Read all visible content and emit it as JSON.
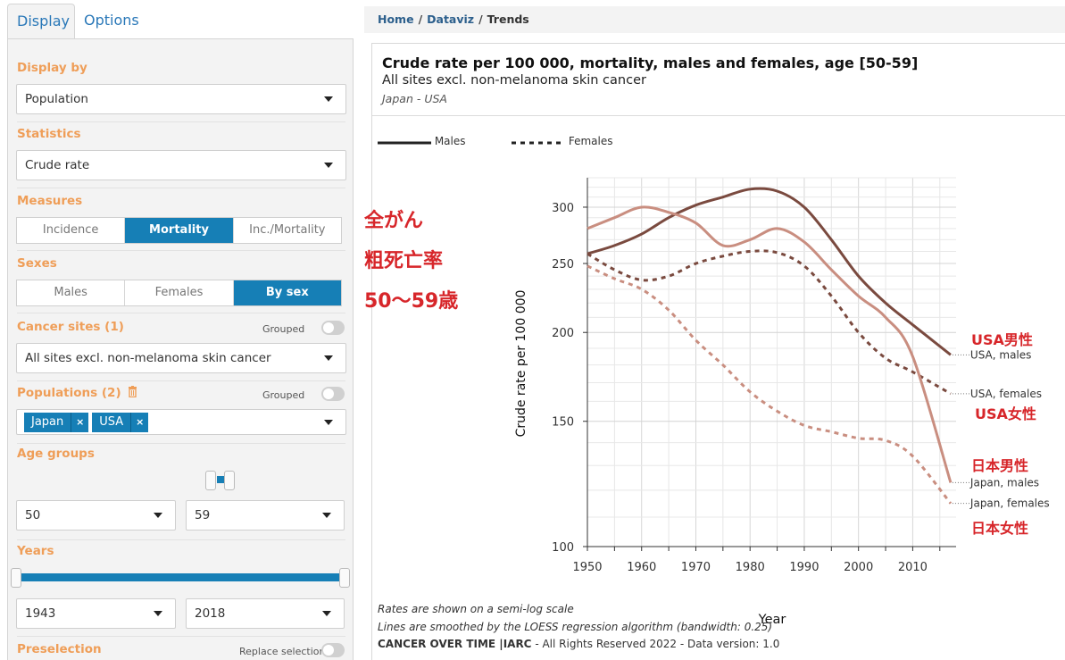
{
  "tabs": [
    {
      "label": "Display"
    },
    {
      "label": "Options"
    }
  ],
  "panel": {
    "display_by": {
      "label": "Display by",
      "value": "Population"
    },
    "statistics": {
      "label": "Statistics",
      "value": "Crude rate"
    },
    "measures": {
      "label": "Measures",
      "options": [
        "Incidence",
        "Mortality",
        "Inc./Mortality"
      ],
      "selected": "Mortality"
    },
    "sexes": {
      "label": "Sexes",
      "options": [
        "Males",
        "Females",
        "By sex"
      ],
      "selected": "By sex"
    },
    "cancer_sites": {
      "label": "Cancer sites (1)",
      "grouped_label": "Grouped",
      "value": "All sites excl. non-melanoma skin cancer"
    },
    "populations": {
      "label": "Populations (2)",
      "grouped_label": "Grouped",
      "chips": [
        "Japan",
        "USA"
      ]
    },
    "age_groups": {
      "label": "Age groups",
      "from": "50",
      "to": "59"
    },
    "years": {
      "label": "Years",
      "from": "1943",
      "to": "2018",
      "slider_from_fraction": 0.0,
      "slider_to_fraction": 1.0
    },
    "preselection": {
      "label": "Preselection",
      "replace_label": "Replace selection"
    }
  },
  "breadcrumb": {
    "items": [
      "Home",
      "Dataviz"
    ],
    "current": "Trends",
    "separator": "/"
  },
  "chart_header": {
    "title": "Crude rate per 100 000, mortality, males and females, age [50-59]",
    "subtitle": "All sites excl. non-melanoma skin cancer",
    "populations": "Japan - USA"
  },
  "legend": [
    {
      "label": "Males",
      "style": "solid"
    },
    {
      "label": "Females",
      "style": "dotted"
    }
  ],
  "notes": {
    "line1": "Rates are shown on a semi-log scale",
    "line2": "Lines are smoothed by the LOESS regression algorithm (bandwidth: 0.25)",
    "footer_brand": "CANCER OVER TIME |IARC",
    "footer_rest": " - All Rights Reserved 2022 - Data version: 1.0"
  },
  "annotations_jp": {
    "heading1": "全がん",
    "heading2": "粗死亡率",
    "heading3": "50～59歳",
    "usa_male": "USA男性",
    "usa_female": "USA女性",
    "japan_male": "日本男性",
    "japan_female": "日本女性"
  },
  "colors": {
    "usa_males": "#7a4a3f",
    "usa_females": "#7a4a3f",
    "japan_males": "#c98e80",
    "japan_females": "#c98e80",
    "accent_label": "#ef9e58",
    "primary": "#167fb6",
    "jp_red": "#d7262a"
  },
  "chart_data": {
    "type": "line",
    "xlabel": "Year",
    "ylabel": "Crude rate per 100 000",
    "y_scale": "log",
    "ylim": [
      100,
      330
    ],
    "xlim": [
      1950,
      2018
    ],
    "x_ticks": [
      1950,
      1960,
      1970,
      1980,
      1990,
      2000,
      2010
    ],
    "y_ticks": [
      100,
      150,
      200,
      250,
      300
    ],
    "grid": true,
    "series": [
      {
        "name": "USA, males",
        "sex": "male",
        "color": "#7a4a3f",
        "dash": "solid",
        "x": [
          1950,
          1955,
          1960,
          1965,
          1970,
          1975,
          1980,
          1985,
          1990,
          1995,
          2000,
          2005,
          2010,
          2017
        ],
        "y": [
          258,
          265,
          275,
          290,
          302,
          310,
          318,
          316,
          300,
          270,
          240,
          220,
          205,
          186
        ]
      },
      {
        "name": "USA, females",
        "sex": "female",
        "color": "#7a4a3f",
        "dash": "dotted",
        "x": [
          1950,
          1955,
          1960,
          1965,
          1970,
          1975,
          1980,
          1985,
          1990,
          1995,
          2000,
          2005,
          2010,
          2017
        ],
        "y": [
          258,
          245,
          237,
          240,
          250,
          256,
          260,
          259,
          248,
          225,
          200,
          184,
          176,
          164
        ]
      },
      {
        "name": "Japan, males",
        "sex": "male",
        "color": "#c98e80",
        "dash": "solid",
        "x": [
          1950,
          1955,
          1960,
          1965,
          1970,
          1975,
          1980,
          1985,
          1990,
          1995,
          2000,
          2005,
          2010,
          2017
        ],
        "y": [
          280,
          290,
          300,
          295,
          285,
          265,
          270,
          280,
          268,
          245,
          225,
          210,
          185,
          123
        ]
      },
      {
        "name": "Japan, females",
        "sex": "female",
        "color": "#c98e80",
        "dash": "dotted",
        "x": [
          1950,
          1955,
          1960,
          1965,
          1970,
          1975,
          1980,
          1985,
          1990,
          1995,
          2000,
          2005,
          2010,
          2017
        ],
        "y": [
          248,
          238,
          230,
          215,
          195,
          180,
          165,
          155,
          148,
          145,
          142,
          141,
          134,
          115
        ]
      }
    ]
  }
}
